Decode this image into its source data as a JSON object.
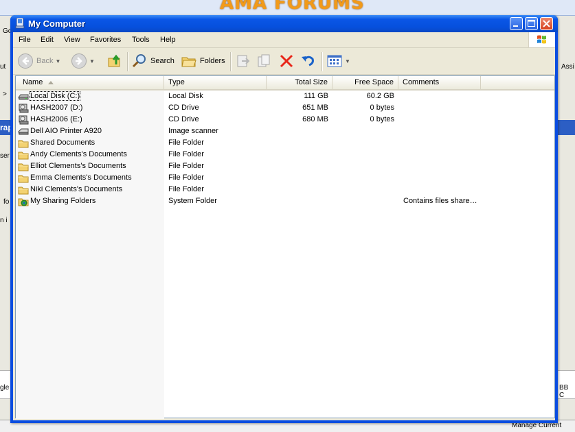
{
  "background": {
    "logo_text": "AMA FORUMS",
    "right_tab": "Assi",
    "left_fragments": [
      "Go",
      "ut",
      ">",
      "rap",
      "ser",
      "fo",
      "n i",
      "gle"
    ],
    "bottom_right": "Manage Current",
    "right_fragment": "BB C"
  },
  "window": {
    "title": "My Computer",
    "menu": [
      "File",
      "Edit",
      "View",
      "Favorites",
      "Tools",
      "Help"
    ],
    "toolbar": {
      "back": "Back",
      "search": "Search",
      "folders": "Folders"
    }
  },
  "columns": {
    "name": "Name",
    "type": "Type",
    "total": "Total Size",
    "free": "Free Space",
    "comments": "Comments"
  },
  "rows": [
    {
      "name": "Local Disk (C:)",
      "type": "Local Disk",
      "total": "111 GB",
      "free": "60.2 GB",
      "comments": "",
      "icon": "hard-disk-icon"
    },
    {
      "name": "HASH2007 (D:)",
      "type": "CD Drive",
      "total": "651 MB",
      "free": "0 bytes",
      "comments": "",
      "icon": "cd-drive-icon"
    },
    {
      "name": "HASH2006 (E:)",
      "type": "CD Drive",
      "total": "680 MB",
      "free": "0 bytes",
      "comments": "",
      "icon": "cd-drive-icon"
    },
    {
      "name": "Dell AIO Printer A920",
      "type": "Image scanner",
      "total": "",
      "free": "",
      "comments": "",
      "icon": "scanner-icon"
    },
    {
      "name": "Shared Documents",
      "type": "File Folder",
      "total": "",
      "free": "",
      "comments": "",
      "icon": "folder-icon"
    },
    {
      "name": "Andy Clements's Documents",
      "type": "File Folder",
      "total": "",
      "free": "",
      "comments": "",
      "icon": "folder-icon"
    },
    {
      "name": "Elliot Clements's Documents",
      "type": "File Folder",
      "total": "",
      "free": "",
      "comments": "",
      "icon": "folder-icon"
    },
    {
      "name": "Emma Clements's Documents",
      "type": "File Folder",
      "total": "",
      "free": "",
      "comments": "",
      "icon": "folder-icon"
    },
    {
      "name": "Niki Clements's Documents",
      "type": "File Folder",
      "total": "",
      "free": "",
      "comments": "",
      "icon": "folder-icon"
    },
    {
      "name": "My Sharing Folders",
      "type": "System Folder",
      "total": "",
      "free": "",
      "comments": "Contains files share…",
      "icon": "sharing-folder-icon"
    }
  ],
  "colors": {
    "title_blue": "#0a56e6",
    "frame_blue": "#0a4de0",
    "chrome": "#ece9d8",
    "close_red": "#d6411f"
  }
}
